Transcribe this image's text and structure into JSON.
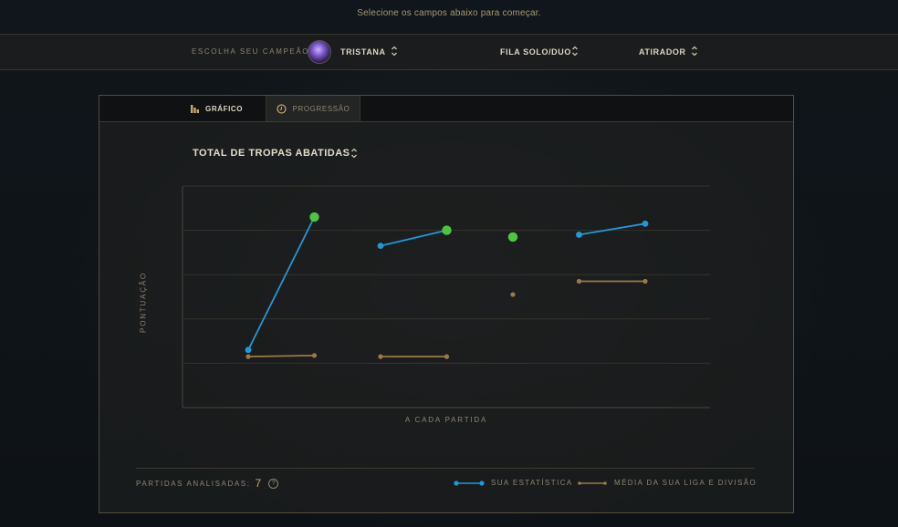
{
  "top_hint": "Selecione os campos abaixo para começar.",
  "selectors": {
    "champion_label": "ESCOLHA SEU CAMPEÃO:",
    "champion": "TRISTANA",
    "queue": "FILA SOLO/DUO",
    "role": "ATIRADOR"
  },
  "tabs": [
    {
      "label": "GRÁFICO",
      "icon": "bar-chart-icon",
      "active": false
    },
    {
      "label": "PROGRESSÃO",
      "icon": "clock-icon",
      "active": true
    }
  ],
  "metric": "TOTAL DE TROPAS ABATIDAS",
  "footer": {
    "analyzed_label": "PARTIDAS ANALISADAS:",
    "analyzed_count": "7",
    "help_icon": "?"
  },
  "legend": [
    {
      "label": "SUA ESTATÍSTICA",
      "color": "#1e9ad6"
    },
    {
      "label": "MÉDIA DA SUA LIGA E DIVISÃO",
      "color": "#9a7a48"
    }
  ],
  "colors": {
    "accent_gold": "#c9a86a",
    "win_green": "#4cc544",
    "stat_blue": "#1e9ad6",
    "avg_brown": "#9a7a48"
  },
  "chart_data": {
    "type": "line",
    "ylabel": "PONTUAÇÃO",
    "xlabel": "A CADA PARTIDA",
    "grid": true,
    "ylim": [
      0,
      100
    ],
    "yticks": [
      0,
      20,
      40,
      60,
      80,
      100
    ],
    "groups": [
      {
        "x": [
          1,
          2
        ],
        "stat": [
          26,
          86
        ],
        "stat_highlight": [
          false,
          true
        ],
        "avg": [
          23,
          23.5
        ]
      },
      {
        "x": [
          3,
          4
        ],
        "stat": [
          73,
          80
        ],
        "stat_highlight": [
          false,
          true
        ],
        "avg": [
          23,
          23
        ]
      },
      {
        "x": [
          5
        ],
        "stat": [
          77
        ],
        "stat_highlight": [
          true
        ],
        "avg": [
          51
        ]
      },
      {
        "x": [
          6,
          7
        ],
        "stat": [
          78,
          83
        ],
        "stat_highlight": [
          false,
          false
        ],
        "avg": [
          57,
          57
        ]
      }
    ]
  }
}
